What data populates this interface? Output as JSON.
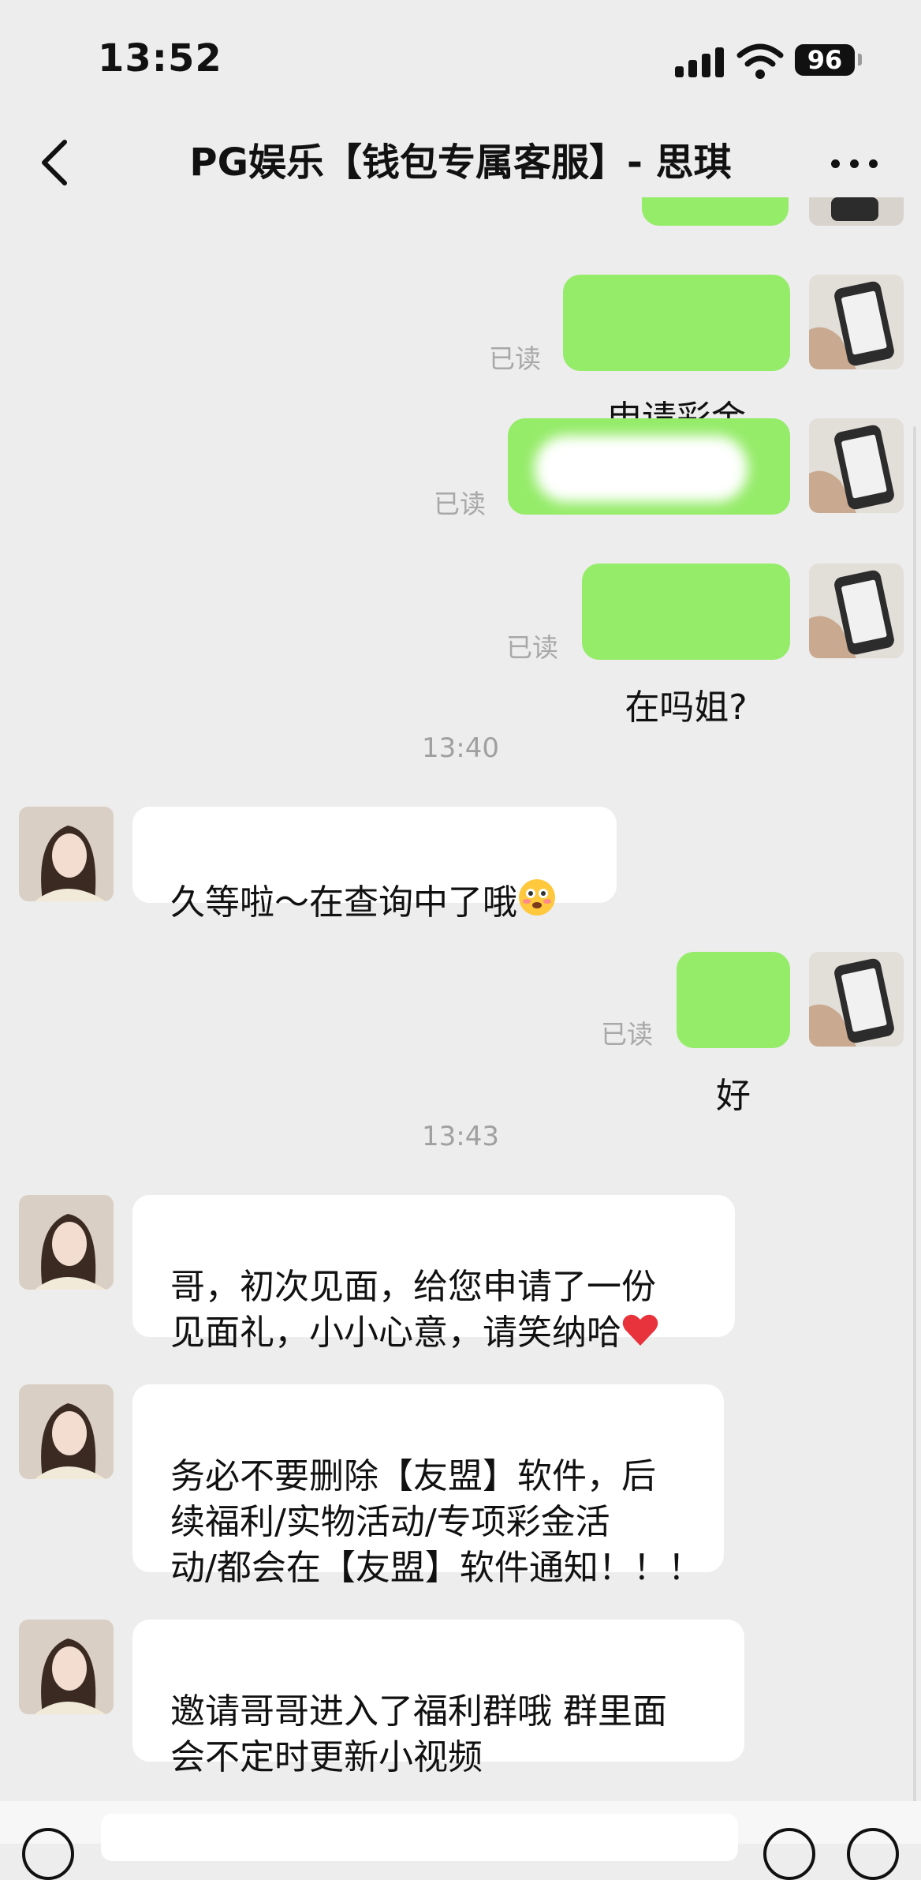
{
  "status_bar": {
    "time": "13:52",
    "battery": "96"
  },
  "header": {
    "title": "PG娱乐【钱包专属客服】- 思琪",
    "back_icon": "chevron-left-icon",
    "more_icon": "more-dots-icon"
  },
  "colors": {
    "outgoing_bubble": "#95ec69",
    "incoming_bubble": "#ffffff",
    "background": "#ededed",
    "read_text": "#a8a8a8"
  },
  "messages": [
    {
      "direction": "out",
      "text": "申请彩金",
      "status": "已读"
    },
    {
      "direction": "out",
      "text": "",
      "status": "已读",
      "redacted": true
    },
    {
      "direction": "out",
      "text": "在吗姐?",
      "status": "已读"
    },
    {
      "direction": "in",
      "text": "久等啦～在查询中了哦",
      "emoji": "flushed-face-icon"
    },
    {
      "direction": "out",
      "text": "好",
      "status": "已读"
    },
    {
      "direction": "in",
      "text": "哥，初次见面，给您申请了一份\n见面礼，小小心意，请笑纳哈",
      "emoji": "red-heart-icon"
    },
    {
      "direction": "in",
      "text": "务必不要删除【友盟】软件，后\n续福利/实物活动/专项彩金活\n动/都会在【友盟】软件通知！！！"
    },
    {
      "direction": "in",
      "text": "邀请哥哥进入了福利群哦 群里面\n会不定时更新小视频"
    }
  ],
  "timestamps": [
    "13:40",
    "13:43"
  ]
}
